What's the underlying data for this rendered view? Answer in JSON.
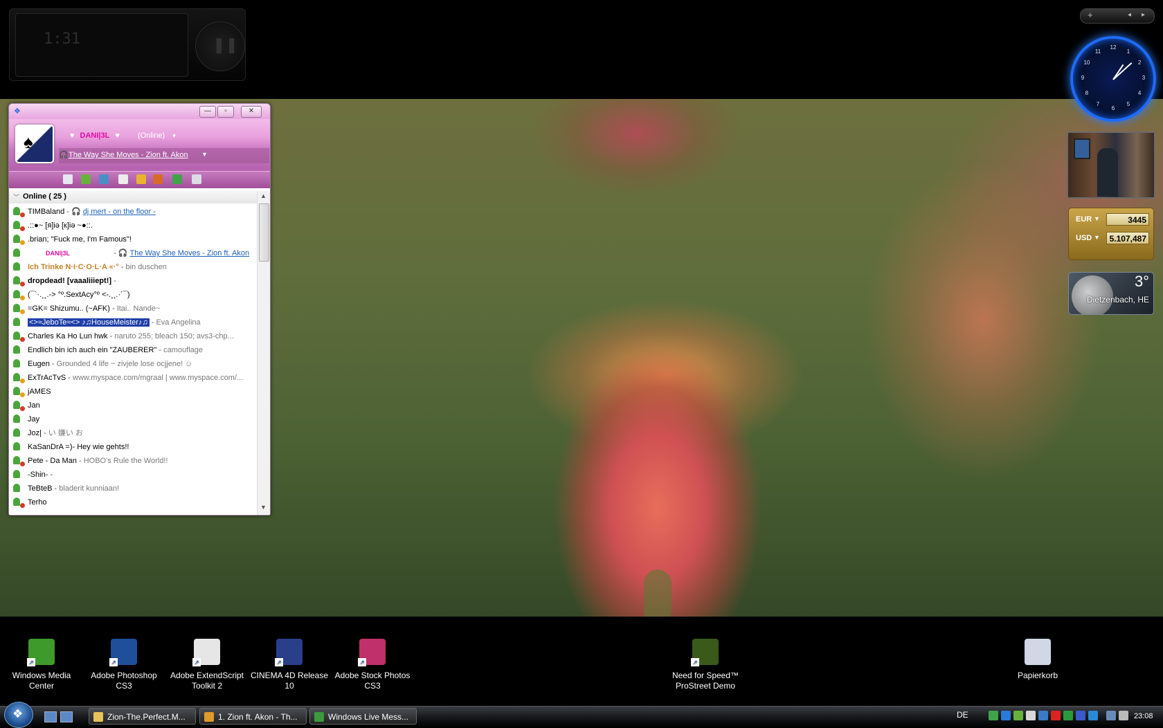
{
  "sidebar": {
    "add_label": "+",
    "prev_label": "◂",
    "next_label": "▸"
  },
  "media_player": {
    "time": "1:31",
    "play_pause_icon": "pause-icon"
  },
  "clock": {
    "numbers": [
      "12",
      "1",
      "2",
      "3",
      "4",
      "5",
      "6",
      "7",
      "8",
      "9",
      "10",
      "11"
    ],
    "hour": 1,
    "minute": 8
  },
  "currency": {
    "rows": [
      {
        "code": "EUR",
        "value": "3445"
      },
      {
        "code": "USD",
        "value": "5.107,487"
      }
    ]
  },
  "weather": {
    "temp": "3°",
    "city": "Dietzenbach, HE"
  },
  "messenger": {
    "display_name": "DANI|3L",
    "heart_left": "♥",
    "heart_right": "♥",
    "status": "(Online)",
    "status_arrow": "▾",
    "personal_message": "The Way She Moves - Zion ft. Akon",
    "group_label": "Online ( 25 )",
    "contacts": [
      {
        "name": "TIMBaland",
        "sep": " - ",
        "pm": "dj mert - on the floor -",
        "pm_type": "music",
        "status": "busy"
      },
      {
        "name": ".::●~ [я]iə [к]iə ~●::.",
        "sep": "",
        "pm": "",
        "pm_type": "",
        "status": "busy"
      },
      {
        "name": ".brian; \"Fuck me, I'm Famous\"!",
        "sep": "",
        "pm": "",
        "pm_type": "",
        "status": "away"
      },
      {
        "name": "DANI|3L",
        "sep": " - ",
        "pm": "The Way She Moves - Zion ft. Akon",
        "pm_type": "music",
        "status": "online"
      },
      {
        "name": "Ich Trinke N·I·C·O·L·A «·°",
        "sep": " - ",
        "pm": "bin duschen",
        "pm_type": "text",
        "status": "online"
      },
      {
        "name": "dropdead! [vaaaliiiept!]",
        "sep": " - ",
        "pm": "",
        "pm_type": "",
        "status": "busy"
      },
      {
        "name": "(¯`·.¸¸.-> °º.SextAcy°º <-.¸¸.·´¯)",
        "sep": "",
        "pm": "",
        "pm_type": "",
        "status": "away"
      },
      {
        "name": "=GK= Shizumu.. (~AFK)",
        "sep": " - ",
        "pm": "Itai.. Nande~",
        "pm_type": "text",
        "status": "away"
      },
      {
        "name": "<>≈JeboTe≈<> ♪♫HouseMeister♪♫",
        "sep": " - ",
        "pm": "Eva Angelina",
        "pm_type": "text",
        "status": "online"
      },
      {
        "name": "Charles Ka Ho Lun      hwk",
        "sep": " - ",
        "pm": "naruto 255; bleach 150; avs3-chp...",
        "pm_type": "text",
        "status": "busy"
      },
      {
        "name": "Endlich bin ich auch ein \"ZAUBERER\"",
        "sep": " - ",
        "pm": "camouflage",
        "pm_type": "text",
        "status": "online"
      },
      {
        "name": "Eugen",
        "sep": " - ",
        "pm": "Grounded 4 life ~ zivjele lose ocjjene! ☺",
        "pm_type": "text",
        "status": "online"
      },
      {
        "name": "ExTrAcTvS",
        "sep": " - ",
        "pm": "www.myspace.com/mgraal   | www.myspace.com/...",
        "pm_type": "text",
        "status": "away"
      },
      {
        "name": "jAMES",
        "sep": "",
        "pm": "",
        "pm_type": "",
        "status": "away"
      },
      {
        "name": "Jan",
        "sep": "",
        "pm": "",
        "pm_type": "",
        "status": "busy"
      },
      {
        "name": "Jay",
        "sep": "",
        "pm": "",
        "pm_type": "",
        "status": "online"
      },
      {
        "name": "Joz|",
        "sep": " - ",
        "pm": "い 嫌い お",
        "pm_type": "text",
        "status": "online"
      },
      {
        "name": "KaSanDrA =)- Hey wie gehts!!",
        "sep": "",
        "pm": "",
        "pm_type": "",
        "status": "online"
      },
      {
        "name": "Pete - Da Man",
        "sep": " - ",
        "pm": "HOBO's Rule the World!!",
        "pm_type": "text",
        "status": "busy"
      },
      {
        "name": "-Shin-",
        "sep": " - ",
        "pm": "",
        "pm_type": "",
        "status": "online"
      },
      {
        "name": "TeBteB",
        "sep": " - ",
        "pm": "bladerit kunniaan!",
        "pm_type": "text",
        "status": "online"
      },
      {
        "name": "Terho",
        "sep": "",
        "pm": "",
        "pm_type": "",
        "status": "busy"
      }
    ]
  },
  "desktop_icons": [
    {
      "label": "Windows Media Center",
      "icon": "media-center-icon",
      "color": "#3f9a2c"
    },
    {
      "label": "Adobe Photoshop CS3",
      "icon": "photoshop-icon",
      "color": "#1f4f9a"
    },
    {
      "label": "Adobe ExtendScript Toolkit 2",
      "icon": "extendscript-icon",
      "color": "#e6e6e6"
    },
    {
      "label": "CINEMA 4D Release 10",
      "icon": "cinema4d-icon",
      "color": "#2a3f8a"
    },
    {
      "label": "Adobe Stock Photos CS3",
      "icon": "stock-photos-icon",
      "color": "#c0306a"
    },
    {
      "label": "Need for Speed™ ProStreet Demo",
      "icon": "nfs-icon",
      "color": "#3a5a1a"
    },
    {
      "label": "Papierkorb",
      "icon": "recycle-bin-icon",
      "color": "#cfd8e4"
    }
  ],
  "taskbar": {
    "tasks": [
      {
        "label": "Zion-The.Perfect.M...",
        "icon": "folder-icon",
        "color": "#e8c25a"
      },
      {
        "label": "1. Zion ft. Akon - Th...",
        "icon": "winamp-icon",
        "color": "#e09a2a"
      },
      {
        "label": "Windows Live Mess...",
        "icon": "messenger-icon",
        "color": "#3c9a3c"
      }
    ],
    "language": "DE",
    "time": "23:08"
  }
}
